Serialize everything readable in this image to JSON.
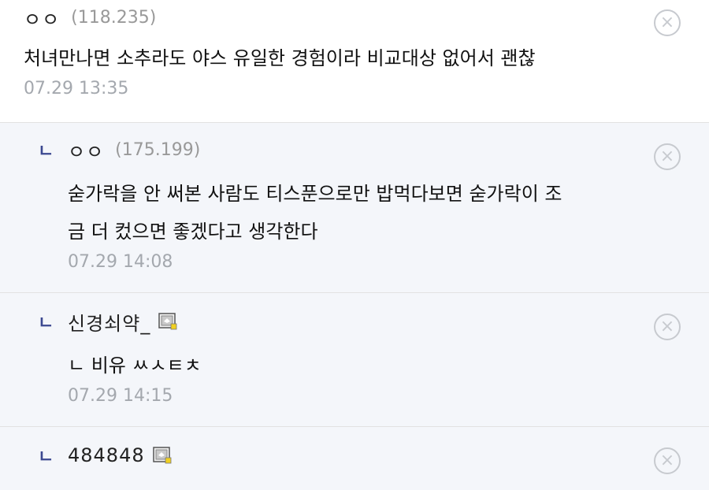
{
  "comments": [
    {
      "nickname": "ㅇㅇ",
      "ip": "(118.235)",
      "text": "처녀만나면 소추라도 야스 유일한 경험이라 비교대상 없어서 괜찮",
      "time": "07.29 13:35",
      "delete_icon": "×"
    }
  ],
  "replies": [
    {
      "marker": "ㄴ",
      "nickname": "ㅇㅇ",
      "ip": "(175.199)",
      "text_line1": "숟가락을 안 써본 사람도 티스푼으로만 밥먹다보면 숟가락이 조",
      "text_line2": "금 더 컸으면 좋겠다고 생각한다",
      "time": "07.29 14:08",
      "delete_icon": "×"
    },
    {
      "marker": "ㄴ",
      "nickname": "신경쇠약_",
      "text": "ㄴ 비유 ㅆㅅㅌㅊ",
      "time": "07.29 14:15",
      "delete_icon": "×",
      "badge_icon": "member-badge-icon"
    },
    {
      "marker": "ㄴ",
      "nickname": "484848",
      "delete_icon": "×",
      "badge_icon": "member-badge-icon"
    }
  ]
}
